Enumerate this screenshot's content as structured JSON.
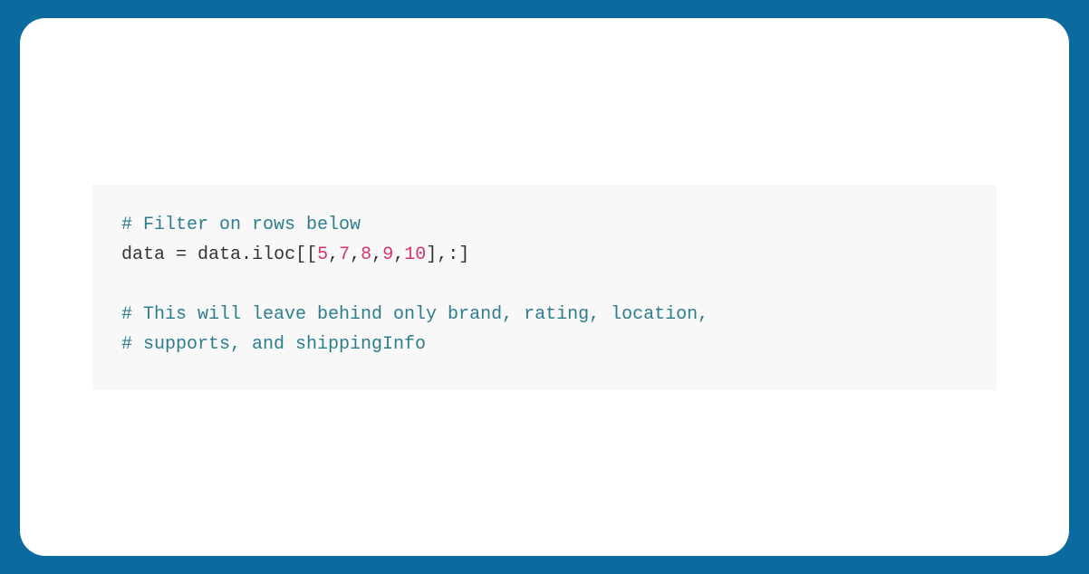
{
  "code": {
    "line1_comment": "# Filter on rows below",
    "line2_lhs": "data",
    "line2_eq": " = ",
    "line2_obj": "data",
    "line2_dot": ".",
    "line2_attr": "iloc",
    "line2_open": "[[",
    "line2_n1": "5",
    "line2_c1": ",",
    "line2_n2": "7",
    "line2_c2": ",",
    "line2_n3": "8",
    "line2_c3": ",",
    "line2_n4": "9",
    "line2_c4": ",",
    "line2_n5": "10",
    "line2_close": "],:]",
    "line3_blank": "",
    "line4_comment": "# This will leave behind only brand, rating, location,",
    "line5_comment": "# supports, and shippingInfo"
  }
}
